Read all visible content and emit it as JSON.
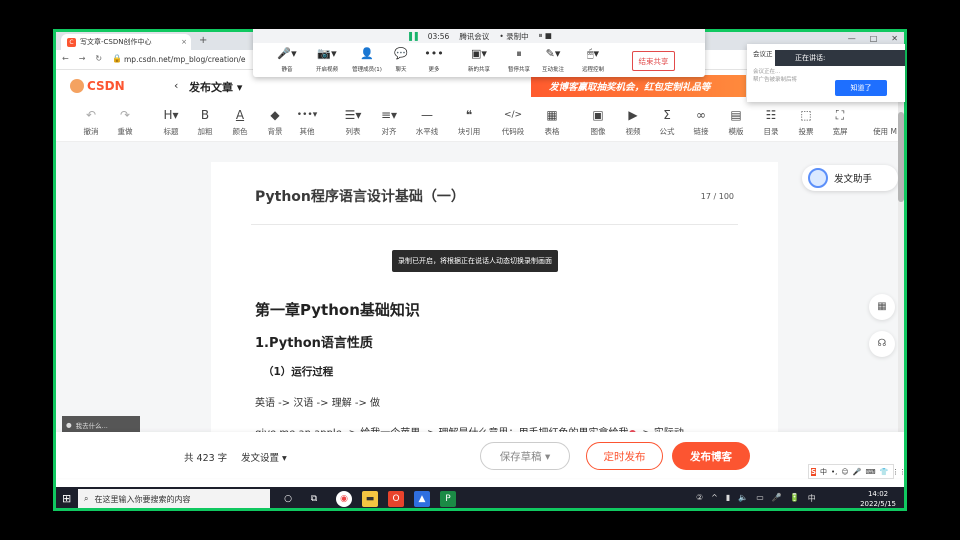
{
  "browser": {
    "tab_title": "写文章-CSDN创作中心",
    "new_tab": "+",
    "url": "mp.csdn.net/mp_blog/creation/e",
    "window_controls": [
      "—",
      "□",
      "✕"
    ]
  },
  "csdn": {
    "logo_text": "CSDN",
    "back_glyph": "‹",
    "page_title": "发布文章 ▾",
    "banner_text": "发博客赢取抽奖机会，红包定制礼品等"
  },
  "toolbar": {
    "items": [
      {
        "icon": "↶",
        "label": "撤消"
      },
      {
        "icon": "↷",
        "label": "重做"
      },
      {
        "icon": "H▾",
        "label": "标题"
      },
      {
        "icon": "B",
        "label": "加粗"
      },
      {
        "icon": "A",
        "label": "颜色"
      },
      {
        "icon": "◆",
        "label": "背景"
      },
      {
        "icon": "•••▾",
        "label": "其他"
      },
      {
        "icon": "☰▾",
        "label": "列表"
      },
      {
        "icon": "≡▾",
        "label": "对齐"
      },
      {
        "icon": "—",
        "label": "水平线"
      },
      {
        "icon": "❝",
        "label": "块引用"
      },
      {
        "icon": "</>",
        "label": "代码段"
      },
      {
        "icon": "▦",
        "label": "表格"
      },
      {
        "icon": "▣",
        "label": "图像"
      },
      {
        "icon": "▶",
        "label": "视频"
      },
      {
        "icon": "Σ",
        "label": "公式"
      },
      {
        "icon": "∞",
        "label": "链接"
      },
      {
        "icon": "▤",
        "label": "模版"
      },
      {
        "icon": "☷",
        "label": "目录"
      },
      {
        "icon": "⬚",
        "label": "投票"
      },
      {
        "icon": "⛶",
        "label": "宽屏"
      },
      {
        "icon": "",
        "label": "使用 M"
      }
    ]
  },
  "editor": {
    "title": "Python程序语言设计基础（一）",
    "title_count": "17 / 100",
    "h1": "第一章Python基础知识",
    "h2": "1.Python语言性质",
    "h3": "（1）运行过程",
    "p1": "英语 -> 汉语 -> 理解 -> 做",
    "p2_start": "give me an apple -> 给我一个苹果 -> 理解是什么意思：用手把红色的果实拿给我",
    "p2_end": " -> 实际动",
    "toast": "录制已开启，将根据正在说话人动态切换录制画面"
  },
  "side": {
    "assistant_label": "发文助手",
    "qr_glyph": "▦",
    "service_glyph": "☊",
    "mini_label": "我去什么..."
  },
  "bottom": {
    "word_count": "共 423 字",
    "publish_settings": "发文设置 ▾",
    "save_draft": "保存草稿 ▾",
    "timed_publish": "定时发布",
    "publish_blog": "发布博客",
    "ime": [
      "S",
      "中",
      "•,",
      "☺",
      "🎤",
      "⌨",
      "👕",
      "⋮⋮"
    ]
  },
  "taskbar": {
    "start": "⊞",
    "search_placeholder": "在这里输入你要搜索的内容",
    "time": "14:02",
    "date": "2022/5/15",
    "lang": "中",
    "tray_icons": [
      "②",
      "^",
      "▮",
      "🔈",
      "▭",
      "🎤",
      "🔋",
      "中",
      "▭"
    ]
  },
  "meeting": {
    "signal": "▐▐",
    "time": "03:56",
    "app_name": "腾讯会议",
    "recording": "• 录制中",
    "controls": "⏸ ■",
    "items": [
      {
        "icon": "🎤▾",
        "label": "静音"
      },
      {
        "icon": "📷▾",
        "label": "开启视频"
      },
      {
        "icon": "👤",
        "label": "管理成员(1)"
      },
      {
        "icon": "💬",
        "label": "聊天"
      },
      {
        "icon": "•••",
        "label": "更多"
      },
      {
        "icon": "▣▾",
        "label": "新的共享"
      },
      {
        "icon": "⏸",
        "label": "暂停共享"
      },
      {
        "icon": "✎▾",
        "label": "互动批注"
      },
      {
        "icon": "🖱▾",
        "label": "远程控制"
      }
    ],
    "end_share": "结束共享"
  },
  "speaker_popup": {
    "header": "会议正",
    "speaking": "正在讲话:",
    "sub_text": "会议正在...\n帮广告被录制后将",
    "ok": "知道了"
  },
  "colors": {
    "accent": "#fc5531",
    "frame": "#10c860",
    "meeting_blue": "#1e6fff"
  }
}
